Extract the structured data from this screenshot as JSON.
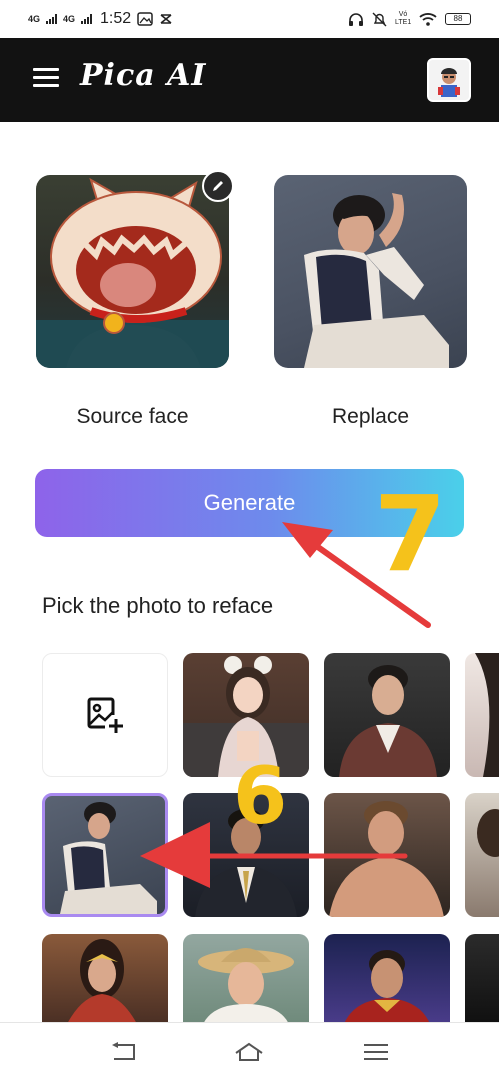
{
  "status_bar": {
    "signal_1": "4G",
    "signal_2": "4G",
    "time": "1:52",
    "volte": "Vó LTE1",
    "battery": "88"
  },
  "app_bar": {
    "title": "Pica AI"
  },
  "faces": {
    "source_label": "Source face",
    "replace_label": "Replace"
  },
  "generate_button": {
    "label": "Generate",
    "gradient": [
      "#8e63ea",
      "#4ad0ea"
    ]
  },
  "gallery": {
    "title": "Pick the photo to reface",
    "selected_index": 1
  },
  "annotations": {
    "step_7": "7",
    "step_6": "6",
    "arrow_color": "#e53b3b",
    "number_color": "#f5c21b"
  }
}
